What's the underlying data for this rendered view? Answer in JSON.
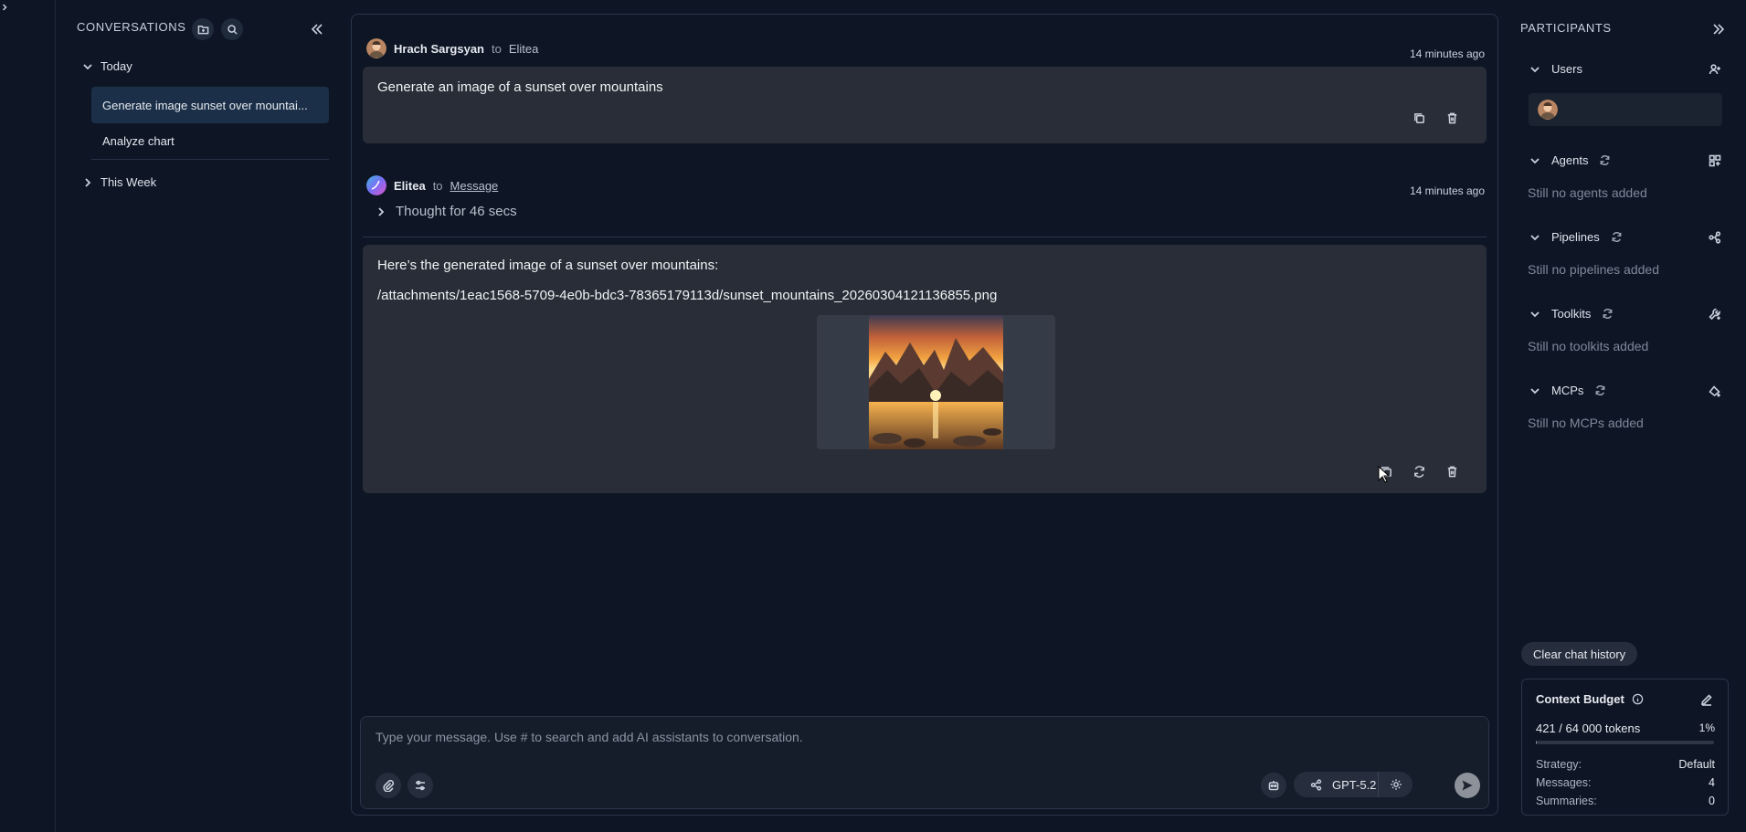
{
  "colors": {
    "background": "#0e1626",
    "accent": "#2f6fa8",
    "bubble": "#282d37",
    "active_item": "#1b3048"
  },
  "sidebar_icons": [
    "logo-icon",
    "briefcase-icon",
    "add-icon",
    "chat-icon",
    "apps-icon",
    "pipelines-icon",
    "credentials-icon",
    "toolkits-icon",
    "grid-icon",
    "mcp-icon",
    "artifacts-icon",
    "reports-icon",
    "settings-icon",
    "bulb-icon",
    "bell-icon",
    "user-avatar"
  ],
  "conversations": {
    "title": "CONVERSATIONS",
    "groups": {
      "today": {
        "label": "Today",
        "items": [
          "Generate image sunset over mountai...",
          "Analyze chart"
        ]
      },
      "this_week": {
        "label": "This Week"
      }
    }
  },
  "chat": {
    "messages": [
      {
        "author": "Hrach Sargsyan",
        "to": "to",
        "target": "Elitea",
        "time": "14 minutes ago",
        "text": "Generate an image of a sunset over mountains"
      },
      {
        "author": "Elitea",
        "to": "to",
        "target": "Message",
        "time": "14 minutes ago",
        "thought": "Thought for 46 secs",
        "text": "Here’s the generated image of a sunset over mountains:",
        "attachment": "/attachments/1eac1568-5709-4e0b-bdc3-78365179113d/sunset_mountains_20260304121136855.png"
      }
    ],
    "input_placeholder": "Type your message. Use # to search and add AI assistants to conversation.",
    "model": "GPT-5.2"
  },
  "participants": {
    "title": "PARTICIPANTS",
    "sections": {
      "users": {
        "label": "Users"
      },
      "agents": {
        "label": "Agents",
        "empty": "Still no agents added"
      },
      "pipelines": {
        "label": "Pipelines",
        "empty": "Still no pipelines added"
      },
      "toolkits": {
        "label": "Toolkits",
        "empty": "Still no toolkits added"
      },
      "mcps": {
        "label": "MCPs",
        "empty": "Still no MCPs added"
      }
    },
    "clear_history": "Clear chat history",
    "budget": {
      "title": "Context Budget",
      "tokens": "421 / 64 000 tokens",
      "percent": "1%",
      "fraction_used": 0.0066,
      "strategy_label": "Strategy:",
      "strategy": "Default",
      "messages_label": "Messages:",
      "messages": "4",
      "summaries_label": "Summaries:",
      "summaries": "0"
    }
  }
}
